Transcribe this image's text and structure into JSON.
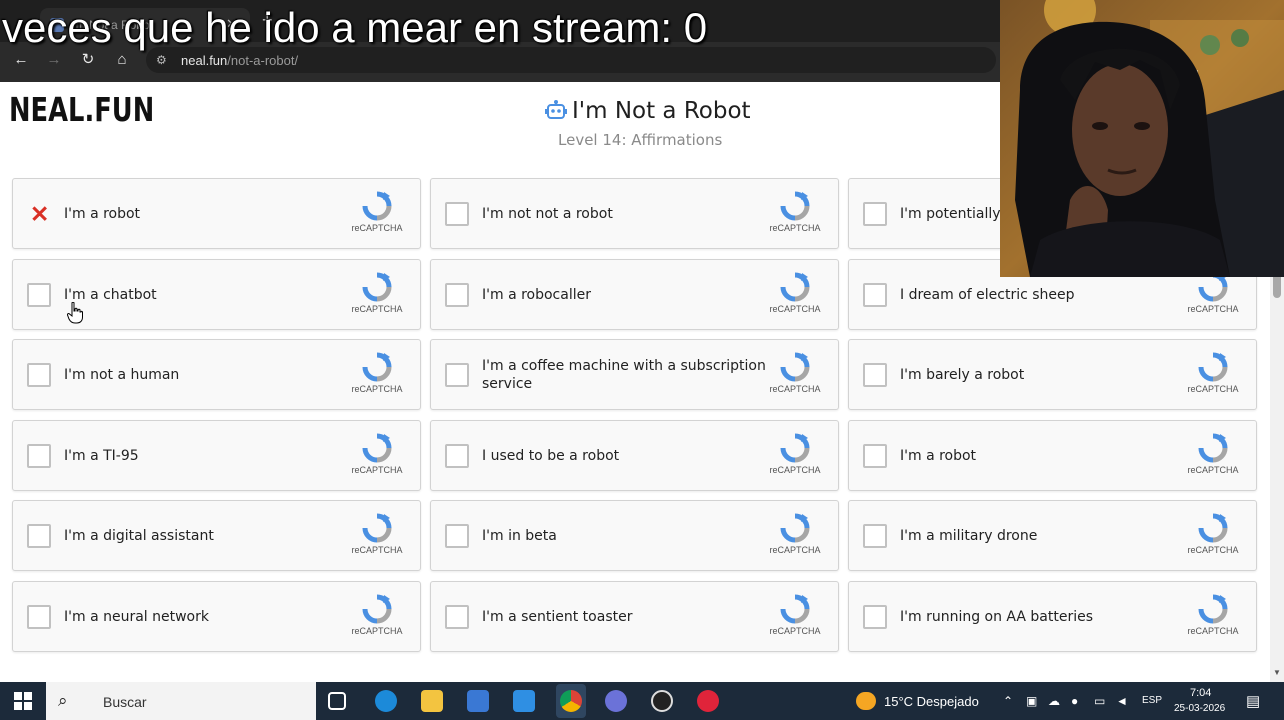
{
  "overlay": {
    "text": "veces que he ido a mear en stream: 0"
  },
  "browser": {
    "tab_title": "I'm Not a Robot",
    "url_domain": "neal.fun",
    "url_path": "/not-a-robot/"
  },
  "site": {
    "logo": "NEAL.FUN",
    "title": "I'm Not a Robot",
    "subtitle": "Level 14: Affirmations"
  },
  "recaptcha_label": "reCAPTCHA",
  "cards": [
    {
      "label": "I'm a robot",
      "state": "failed"
    },
    {
      "label": "I'm not not a robot",
      "state": "unchecked"
    },
    {
      "label": "I'm potentially a",
      "state": "unchecked"
    },
    {
      "label": "I'm a chatbot",
      "state": "unchecked"
    },
    {
      "label": "I'm a robocaller",
      "state": "unchecked"
    },
    {
      "label": "I dream of electric sheep",
      "state": "unchecked"
    },
    {
      "label": "I'm not a human",
      "state": "unchecked"
    },
    {
      "label": "I'm a coffee machine with a subscription service",
      "state": "unchecked"
    },
    {
      "label": "I'm barely a robot",
      "state": "unchecked"
    },
    {
      "label": "I'm a TI-95",
      "state": "unchecked"
    },
    {
      "label": "I used to be a robot",
      "state": "unchecked"
    },
    {
      "label": "I'm a robot",
      "state": "unchecked"
    },
    {
      "label": "I'm a digital assistant",
      "state": "unchecked"
    },
    {
      "label": "I'm in beta",
      "state": "unchecked"
    },
    {
      "label": "I'm a military drone",
      "state": "unchecked"
    },
    {
      "label": "I'm a neural network",
      "state": "unchecked"
    },
    {
      "label": "I'm a sentient toaster",
      "state": "unchecked"
    },
    {
      "label": "I'm running on AA batteries",
      "state": "unchecked"
    }
  ],
  "taskbar": {
    "search_placeholder": "Buscar",
    "weather": "15°C  Despejado",
    "language": "ESP",
    "time": "7:04",
    "date": "25-03-2026"
  },
  "colors": {
    "accent_fail": "#d93025",
    "recaptcha_blue": "#4a90e2",
    "recaptcha_grey": "#a6a6a6"
  }
}
